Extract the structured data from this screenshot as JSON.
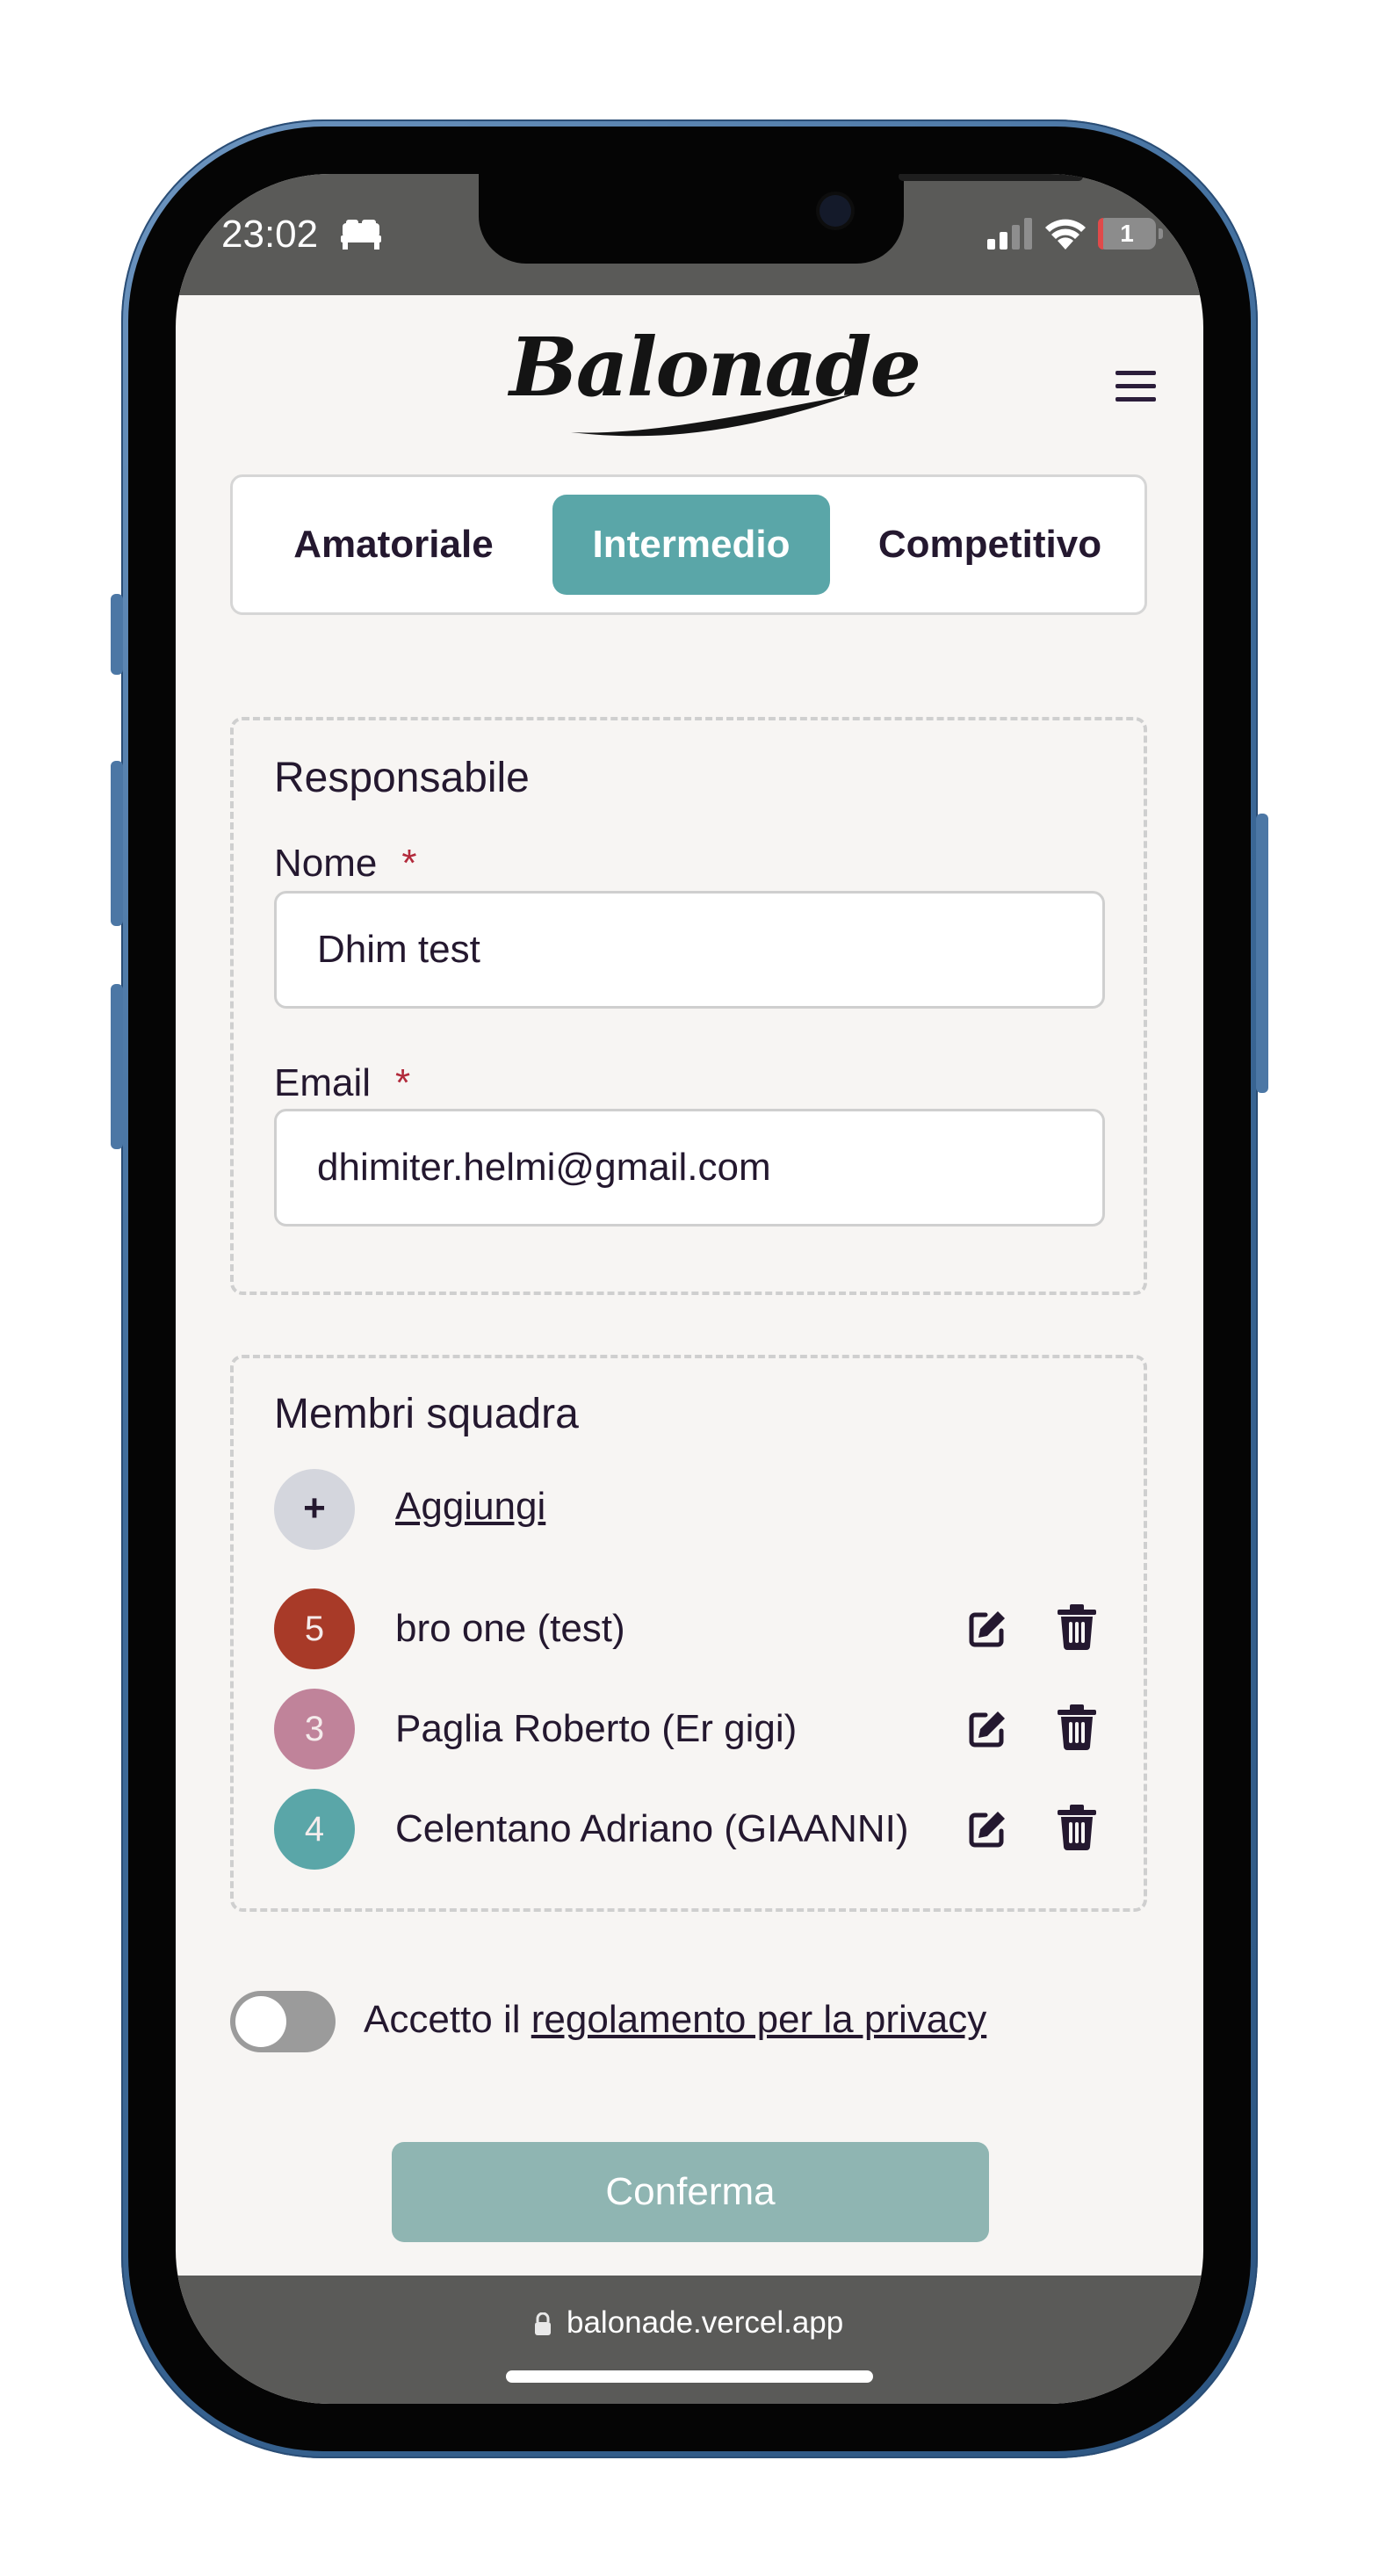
{
  "status_bar": {
    "time": "23:02",
    "battery": "1",
    "icons": [
      "bed-icon",
      "signal-icon",
      "wifi-icon",
      "battery-icon"
    ]
  },
  "header": {
    "logo_text": "Balonade",
    "menu_icon": "hamburger-menu-icon"
  },
  "tabs": [
    {
      "label": "Amatoriale",
      "active": false
    },
    {
      "label": "Intermedio",
      "active": true
    },
    {
      "label": "Competitivo",
      "active": false
    }
  ],
  "responsabile": {
    "title": "Responsabile",
    "name_label": "Nome",
    "name_value": "Dhim test",
    "email_label": "Email",
    "email_value": "dhimiter.helmi@gmail.com",
    "required_marker": "*"
  },
  "members": {
    "title": "Membri squadra",
    "add_symbol": "+",
    "add_label": "Aggiungi",
    "list": [
      {
        "number": "5",
        "name": "bro one (test)",
        "color": "#a83a28"
      },
      {
        "number": "3",
        "name": "Paglia Roberto (Er gigi)",
        "color": "#c0839a"
      },
      {
        "number": "4",
        "name": "Celentano Adriano (GIAANNI)",
        "color": "#5aa6a8"
      }
    ]
  },
  "privacy": {
    "prefix": "Accetto il ",
    "link": "regolamento per la privacy",
    "accepted": false
  },
  "confirm_label": "Conferma",
  "browser": {
    "url": "balonade.vercel.app"
  },
  "colors": {
    "accent": "#5aa6a8",
    "text": "#24182f",
    "required": "#b22a3b",
    "confirm_disabled": "#8fb5b2",
    "page_bg": "#f7f5f3",
    "phone_frame": "#3f6c9b"
  }
}
